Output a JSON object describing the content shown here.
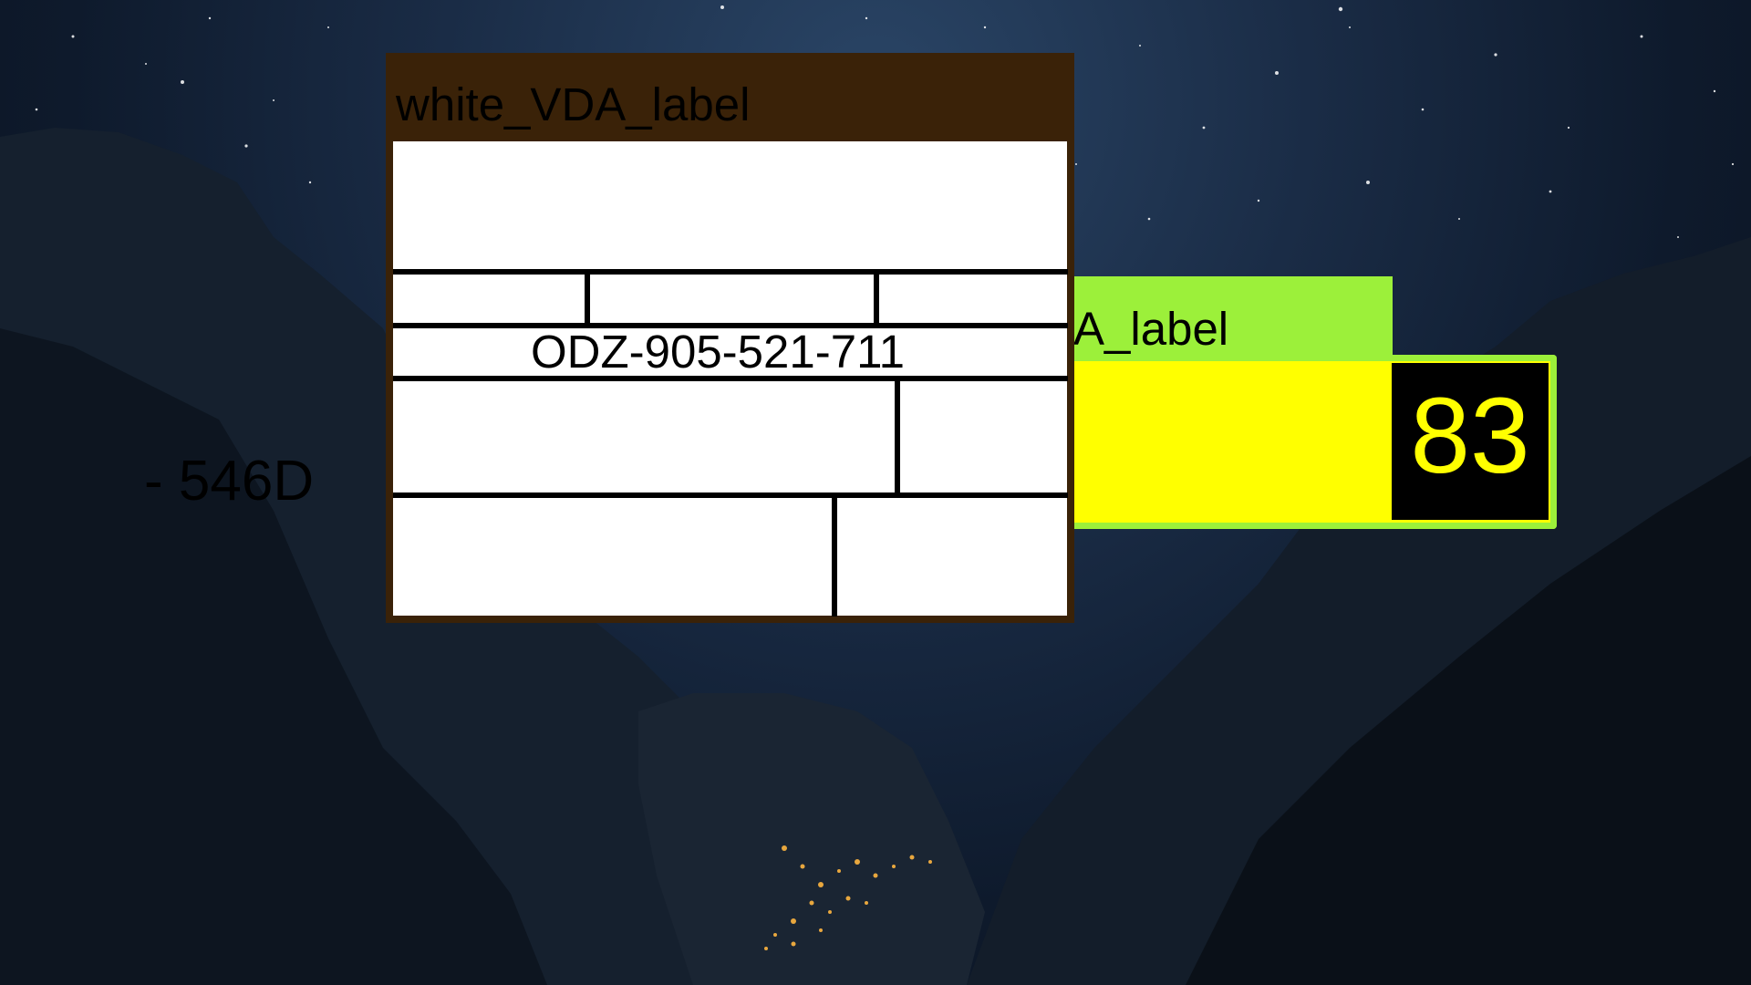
{
  "desktop": {
    "wallpaper": "night-mountain-valley"
  },
  "windows": [
    {
      "id": "brown-window",
      "title": "white_VDA_label",
      "colors": {
        "frame": "#3a2208",
        "body": "#ffffff"
      },
      "fields": {
        "identifier": "ODZ-905-521-711"
      }
    },
    {
      "id": "green-window",
      "title": "A_label",
      "colors": {
        "frame": "#9cf03a",
        "body": "#ffff00",
        "score_bg": "#000000",
        "score_fg": "#ffff00"
      },
      "fields": {
        "code": "- 546D",
        "score": "83"
      }
    }
  ]
}
